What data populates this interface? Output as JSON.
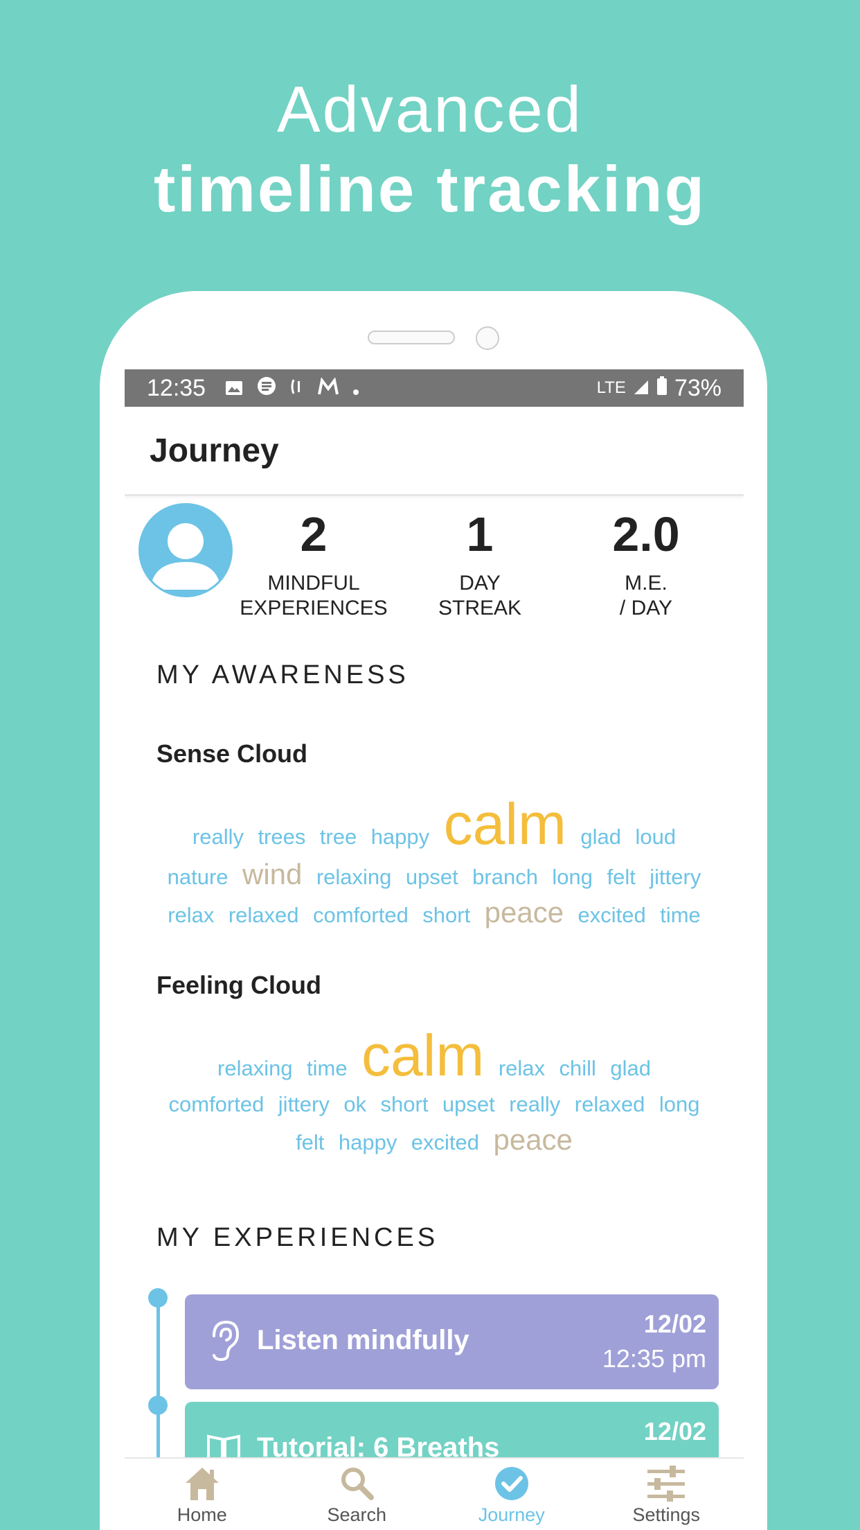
{
  "hero": {
    "line1": "Advanced",
    "line2": "timeline tracking"
  },
  "status_bar": {
    "time": "12:35",
    "network": "LTE",
    "battery": "73%"
  },
  "app_bar": {
    "title": "Journey"
  },
  "stats": [
    {
      "value": "2",
      "label1": "MINDFUL",
      "label2": "EXPERIENCES"
    },
    {
      "value": "1",
      "label1": "DAY",
      "label2": "STREAK"
    },
    {
      "value": "2.0",
      "label1": "M.E.",
      "label2": "/ DAY"
    }
  ],
  "awareness": {
    "title": "MY AWARENESS",
    "sense_cloud": {
      "title": "Sense Cloud",
      "rows": [
        [
          "really",
          "trees",
          "tree",
          "happy",
          "calm",
          "glad",
          "loud"
        ],
        [
          "nature",
          "wind",
          "relaxing",
          "upset",
          "branch",
          "long",
          "felt",
          "jittery"
        ],
        [
          "relax",
          "relaxed",
          "comforted",
          "short",
          "peace",
          "excited",
          "time"
        ]
      ]
    },
    "feeling_cloud": {
      "title": "Feeling Cloud",
      "rows": [
        [
          "relaxing",
          "time",
          "calm",
          "relax",
          "chill",
          "glad"
        ],
        [
          "comforted",
          "jittery",
          "ok",
          "short",
          "upset",
          "really",
          "relaxed",
          "long"
        ],
        [
          "felt",
          "happy",
          "excited",
          "peace"
        ]
      ]
    }
  },
  "experiences": {
    "title": "MY EXPERIENCES",
    "items": [
      {
        "title": "Listen mindfully",
        "date": "12/02",
        "time": "12:35 pm",
        "icon": "ear-icon",
        "color": "#a0a0d8"
      },
      {
        "title": "Tutorial: 6 Breaths",
        "date": "12/02",
        "time": "",
        "icon": "book-icon",
        "color": "#72d2c4"
      }
    ]
  },
  "tabs": [
    {
      "label": "Home",
      "icon": "home-icon"
    },
    {
      "label": "Search",
      "icon": "search-icon"
    },
    {
      "label": "Journey",
      "icon": "check-circle-icon",
      "active": true
    },
    {
      "label": "Settings",
      "icon": "sliders-icon"
    }
  ],
  "colors": {
    "background": "#72d2c4",
    "accent": "#6cc3e5",
    "highlight": "#f4be3c",
    "muted": "#c7b99e",
    "card_purple": "#a0a0d8"
  }
}
